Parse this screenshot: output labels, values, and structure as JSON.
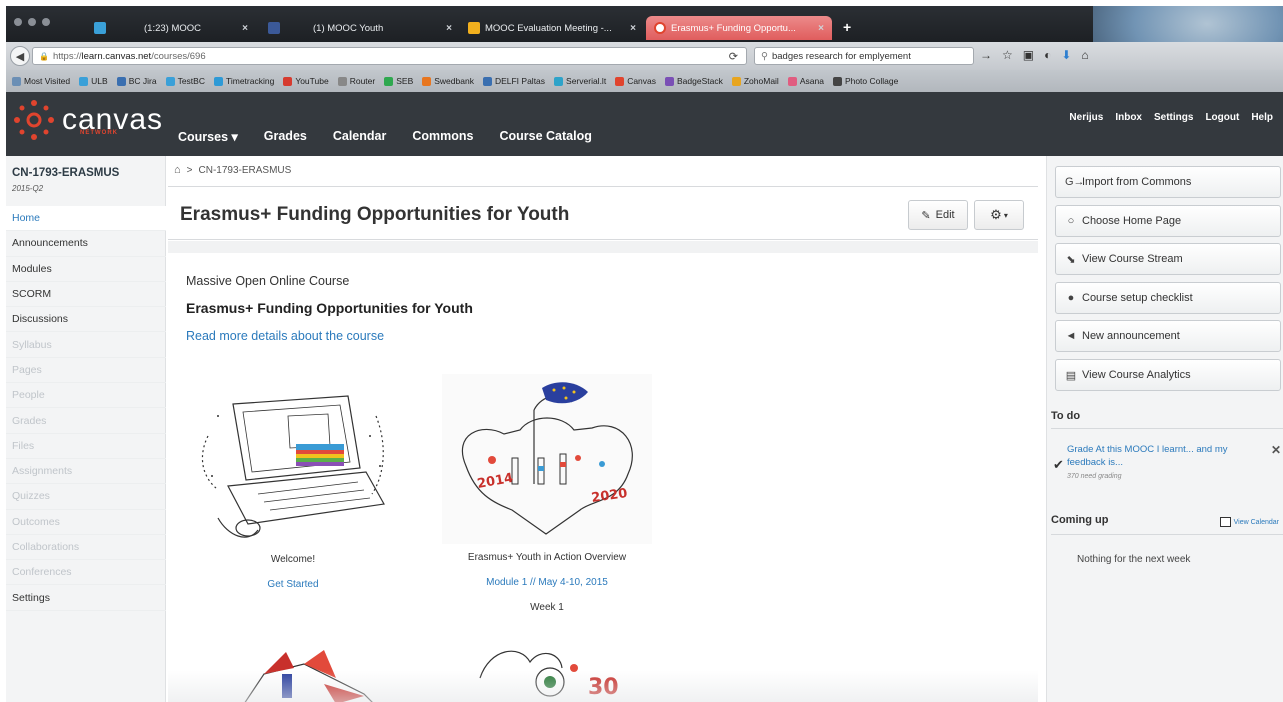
{
  "browser": {
    "tabs": [
      {
        "title": "(1:23) MOOC",
        "close": "×"
      },
      {
        "title": "(1) MOOC Youth",
        "close": "×"
      },
      {
        "title": "MOOC Evaluation Meeting -...",
        "close": "×"
      },
      {
        "title": "Erasmus+ Funding Opportu...",
        "close": "×"
      }
    ],
    "new_tab": "+",
    "url_scheme": "https://",
    "url_host": "learn.canvas.net",
    "url_path": "/courses/696",
    "search_value": "badges research for emplyement",
    "bookmarks": [
      {
        "label": "Most Visited",
        "color": "#6b8fb5"
      },
      {
        "label": "ULB",
        "color": "#3aa0d8"
      },
      {
        "label": "BC Jira",
        "color": "#3a6fb0"
      },
      {
        "label": "TestBC",
        "color": "#3aa0d8"
      },
      {
        "label": "Timetracking",
        "color": "#2e9ad6"
      },
      {
        "label": "YouTube",
        "color": "#d63b2f"
      },
      {
        "label": "Router",
        "color": "#888888"
      },
      {
        "label": "SEB",
        "color": "#2fa84f"
      },
      {
        "label": "Swedbank",
        "color": "#e8761f"
      },
      {
        "label": "DELFI Paltas",
        "color": "#3a6fb0"
      },
      {
        "label": "Serverial.lt",
        "color": "#2ea3c9"
      },
      {
        "label": "Canvas",
        "color": "#e0442e"
      },
      {
        "label": "BadgeStack",
        "color": "#7a4fb5"
      },
      {
        "label": "ZohoMail",
        "color": "#e8a51f"
      },
      {
        "label": "Asana",
        "color": "#e05d80"
      },
      {
        "label": "Photo Collage",
        "color": "#444444"
      }
    ]
  },
  "header": {
    "logo_word": "canvas",
    "logo_sub": "NETWORK",
    "nav": [
      {
        "label": "Courses ▾"
      },
      {
        "label": "Grades"
      },
      {
        "label": "Calendar"
      },
      {
        "label": "Commons"
      },
      {
        "label": "Course Catalog"
      }
    ],
    "user_nav": [
      {
        "label": "Nerijus"
      },
      {
        "label": "Inbox"
      },
      {
        "label": "Settings"
      },
      {
        "label": "Logout"
      },
      {
        "label": "Help"
      }
    ]
  },
  "course": {
    "code": "CN-1793-ERASMUS",
    "term": "2015-Q2",
    "nav": [
      {
        "label": "Home",
        "state": "active"
      },
      {
        "label": "Announcements",
        "state": "normal"
      },
      {
        "label": "Modules",
        "state": "normal"
      },
      {
        "label": "SCORM",
        "state": "normal"
      },
      {
        "label": "Discussions",
        "state": "normal"
      },
      {
        "label": "Syllabus",
        "state": "muted"
      },
      {
        "label": "Pages",
        "state": "muted"
      },
      {
        "label": "People",
        "state": "muted"
      },
      {
        "label": "Grades",
        "state": "muted"
      },
      {
        "label": "Files",
        "state": "muted"
      },
      {
        "label": "Assignments",
        "state": "muted"
      },
      {
        "label": "Quizzes",
        "state": "muted"
      },
      {
        "label": "Outcomes",
        "state": "muted"
      },
      {
        "label": "Collaborations",
        "state": "muted"
      },
      {
        "label": "Conferences",
        "state": "muted"
      },
      {
        "label": "Settings",
        "state": "normal"
      }
    ]
  },
  "main": {
    "breadcrumb_sep": ">",
    "breadcrumb_course": "CN-1793-ERASMUS",
    "title": "Erasmus+ Funding Opportunities for Youth",
    "edit_label": "Edit",
    "kicker": "Massive Open Online Course",
    "heading": "Erasmus+ Funding Opportunities for Youth",
    "read_more": "Read more details about the course",
    "cards": [
      {
        "caption": "Welcome!",
        "link": "Get Started",
        "week": ""
      },
      {
        "caption": "Erasmus+ Youth in Action Overview",
        "link": "Module 1 // May 4-10, 2015",
        "week": "Week 1"
      }
    ],
    "sketch_years": [
      "2014",
      "2020"
    ]
  },
  "sidebar": {
    "buttons": [
      {
        "label": "Import from Commons",
        "icon": "import-icon"
      },
      {
        "label": "Choose Home Page",
        "icon": "home-page-icon"
      },
      {
        "label": "View Course Stream",
        "icon": "stream-icon"
      },
      {
        "label": "Course setup checklist",
        "icon": "question-icon"
      },
      {
        "label": "New announcement",
        "icon": "megaphone-icon"
      },
      {
        "label": "View Course Analytics",
        "icon": "analytics-icon"
      }
    ],
    "todo_heading": "To do",
    "todo_title": "Grade At this MOOC I learnt... and my feedback is...",
    "todo_sub": "370 need grading",
    "coming_heading": "Coming up",
    "view_calendar": "View Calendar",
    "nothing": "Nothing for the next week"
  }
}
